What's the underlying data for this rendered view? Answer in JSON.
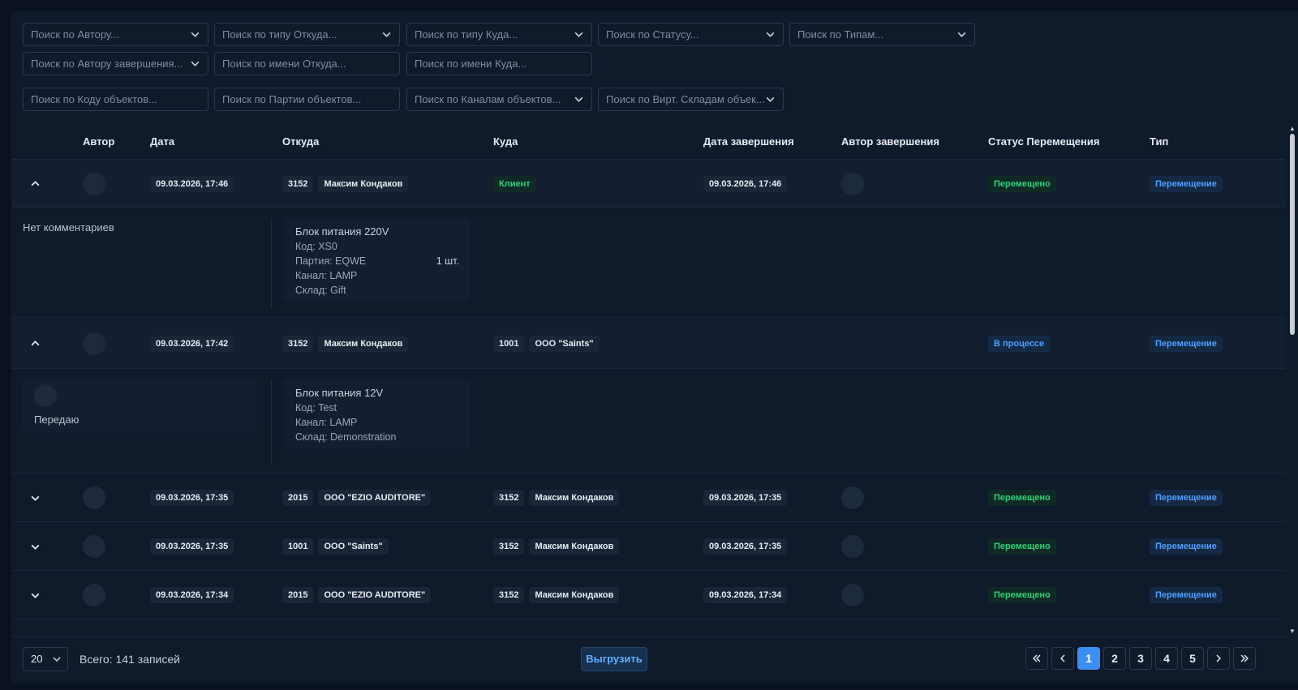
{
  "filters": {
    "row1": [
      {
        "placeholder": "Поиск по Автору...",
        "dropdown": true
      },
      {
        "placeholder": "Поиск по типу Откуда...",
        "dropdown": true
      },
      {
        "placeholder": "Поиск по типу Куда...",
        "dropdown": true
      },
      {
        "placeholder": "Поиск по Статусу...",
        "dropdown": true
      },
      {
        "placeholder": "Поиск по Типам...",
        "dropdown": true
      }
    ],
    "row2": [
      {
        "placeholder": "Поиск по Автору завершения...",
        "dropdown": true
      },
      {
        "placeholder": "Поиск по имени Откуда...",
        "dropdown": false
      },
      {
        "placeholder": "Поиск по имени Куда...",
        "dropdown": false
      }
    ],
    "row3": [
      {
        "placeholder": "Поиск по Коду объектов...",
        "dropdown": false
      },
      {
        "placeholder": "Поиск по Партии объектов...",
        "dropdown": false
      },
      {
        "placeholder": "Поиск по Каналам объектов...",
        "dropdown": true
      },
      {
        "placeholder": "Поиск по Вирт. Складам объек...",
        "dropdown": true
      }
    ]
  },
  "table": {
    "headers": {
      "author": "Автор",
      "date": "Дата",
      "from": "Откуда",
      "to": "Куда",
      "end_date": "Дата завершения",
      "end_author": "Автор завершения",
      "status": "Статус Перемещения",
      "type": "Тип"
    },
    "rows": [
      {
        "expanded": true,
        "date": "09.03.2026, 17:46",
        "from_code": "3152",
        "from_name": "Максим Кондаков",
        "to_code": "",
        "to_name": "",
        "to_badge": "Клиент",
        "end_date": "09.03.2026, 17:46",
        "status": "Перемещено",
        "status_kind": "done",
        "type": "Перемещение",
        "comment": "Нет комментариев",
        "item": {
          "title": "Блок питания 220V",
          "code": "Код: XS0",
          "party": "Партия: EQWE",
          "qty": "1 шт.",
          "channel": "Канал: LAMP",
          "warehouse": "Склад: Gift"
        }
      },
      {
        "expanded": true,
        "date": "09.03.2026, 17:42",
        "from_code": "3152",
        "from_name": "Максим Кондаков",
        "to_code": "1001",
        "to_name": "ООО \"Saints\"",
        "end_date": "",
        "status": "В процессе",
        "status_kind": "progress",
        "type": "Перемещение",
        "comment": "Передаю",
        "item": {
          "title": "Блок питания 12V",
          "code": "Код: Test",
          "channel": "Канал: LAMP",
          "warehouse": "Склад: Demonstration"
        }
      },
      {
        "expanded": false,
        "date": "09.03.2026, 17:35",
        "from_code": "2015",
        "from_name": "ООО \"EZIO AUDITORE\"",
        "to_code": "3152",
        "to_name": "Максим Кондаков",
        "end_date": "09.03.2026, 17:35",
        "status": "Перемещено",
        "type": "Перемещение"
      },
      {
        "expanded": false,
        "date": "09.03.2026, 17:35",
        "from_code": "1001",
        "from_name": "ООО \"Saints\"",
        "to_code": "3152",
        "to_name": "Максим Кондаков",
        "end_date": "09.03.2026, 17:35",
        "status": "Перемещено",
        "type": "Перемещение"
      },
      {
        "expanded": false,
        "date": "09.03.2026, 17:34",
        "from_code": "2015",
        "from_name": "ООО \"EZIO AUDITORE\"",
        "to_code": "3152",
        "to_name": "Максим Кондаков",
        "end_date": "09.03.2026, 17:34",
        "status": "Перемещено",
        "type": "Перемещение"
      }
    ]
  },
  "footer": {
    "page_size": "20",
    "total": "Всего: 141 записей",
    "export_label": "Выгрузить",
    "pages": [
      "1",
      "2",
      "3",
      "4",
      "5"
    ],
    "current_page": "1"
  },
  "icons": {
    "dropdown": "chevron-down-icon",
    "collapse": "chevron-up-icon",
    "expand": "chevron-down-icon",
    "first": "double-chevron-left-icon",
    "prev": "chevron-left-icon",
    "next": "chevron-right-icon",
    "last": "double-chevron-right-icon"
  },
  "colors": {
    "background": "#0f1a2b",
    "accent": "#3b8ff3",
    "status_done": "#2ed17a",
    "status_progress": "#4d9fff"
  }
}
